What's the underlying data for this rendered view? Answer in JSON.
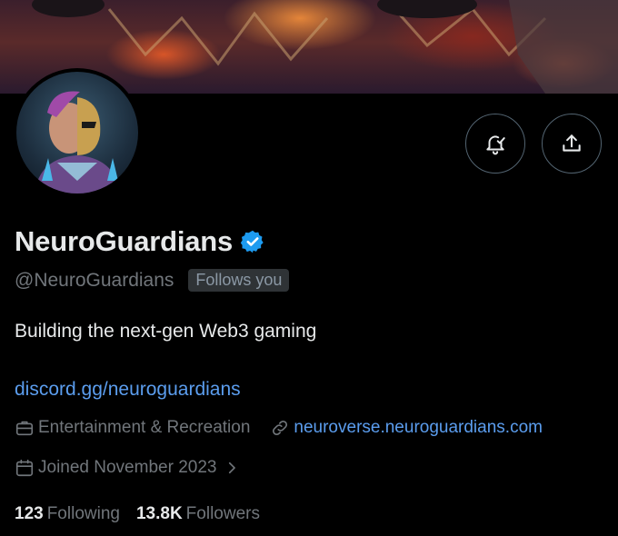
{
  "profile": {
    "display_name": "NeuroGuardians",
    "handle": "@NeuroGuardians",
    "follows_you": "Follows you",
    "bio": "Building the next-gen Web3 gaming",
    "link": "discord.gg/neuroguardians",
    "category": "Entertainment & Recreation",
    "website": "neuroverse.neuroguardians.com",
    "joined": "Joined November 2023",
    "following_count": "123",
    "following_label": "Following",
    "followers_count": "13.8K",
    "followers_label": "Followers"
  },
  "icons": {
    "verified": "verified-badge-icon",
    "bell": "notification-bell-icon",
    "share": "share-icon",
    "category": "briefcase-icon",
    "website": "link-icon",
    "joined": "calendar-icon",
    "chevron": "chevron-right-icon"
  },
  "colors": {
    "background": "#000000",
    "text_primary": "#e7e9ea",
    "text_secondary": "#71767b",
    "link": "#5b9dee",
    "verified": "#1d9bf0",
    "border": "#536471"
  }
}
